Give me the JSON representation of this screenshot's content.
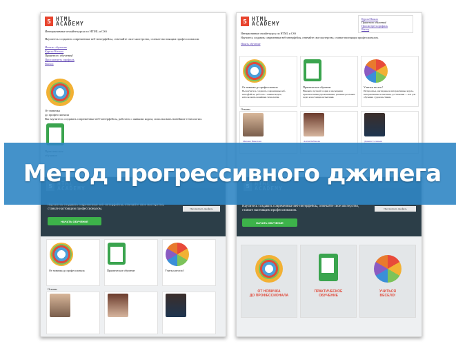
{
  "banner": {
    "title": "Метод прогрессивного джипега"
  },
  "logo": {
    "mark": "5",
    "line1": "HTML",
    "line2": "ACADEMY"
  },
  "top_left": {
    "tagline": "Интерактивные онлайн-курсы по HTML и CSS",
    "headline": "Научитесь создавать современные веб-интерфейсы, отвечайте свое мастерство, станьте настоящим профессионалом",
    "links": [
      "Начать обучение",
      "Курсы/Начало",
      "Приятного обучения!",
      "Просмотреть профиль",
      "Выход"
    ],
    "level_title_1": "От новичка",
    "level_title_2": "до профессионала",
    "level_text": "Вы научитесь создавать современные веб-интерфейсы, работать с живыми кодом, использовать новейшие технологии.",
    "practice_1": "Практическое",
    "practice_2": "обучение"
  },
  "top_right": {
    "links": [
      "Курсы/Начало",
      "Приятного обучения!",
      "Просмотреть профиль",
      "Выход"
    ],
    "tagline": "Интерактивные онлайн-курсы по HTML и CSS",
    "headline": "Научитесь создавать современные веб-интерфейсы, отвечайте свое мастерство, станьте настоящим профессионалом.",
    "cta": "Начать обучение",
    "col1_title": "От новичка до профессионала",
    "col1_text": "Вы научитесь создавать современные веб-интерфейсы, работать с живым кодом, использовать новейшие технологии.",
    "col2_title": "Практическое обучение",
    "col2_text": "Никаких скучной теории и насыщения практическими упражнениями, решение реальных задач и настоящие испытания.",
    "col3_title": "Учиться весело!",
    "col3_text": "Интересные, наглядные и интерактивные курсы, интерактивные испытания, достижения — всё для обучения с удовольствием.",
    "reviews": "Отзывы",
    "person1": "Михаил Николаев",
    "person2": "Алёна Бибенова",
    "person3": "Данила Соловьев"
  },
  "bottom_left": {
    "headline": "Научитесь создавать современные веб-интерфейсы, отвечайте свое мастерство, станьте настоящим профессионалом.",
    "cta": "НАЧАТЬ ОБУЧЕНИЕ",
    "profile": "Просмотреть профиль",
    "col1_title": "От новичка до профессионала",
    "col2_title": "Практическое обучение",
    "col3_title": "Учиться весело!",
    "reviews": "Отзывы"
  },
  "bottom_right": {
    "headline": "Научитесь создавать современные веб-интерфейсы, отвечайте свое мастерство, станьте настоящим профессионалом.",
    "cta": "НАЧАТЬ ОБУЧЕНИЕ",
    "profile": "Просмотреть профиль",
    "card1_title_1": "ОТ НОВИЧКА",
    "card1_title_2": "ДО ПРОФЕССИОНАЛА",
    "card2_title_1": "ПРАКТИЧЕСКОЕ",
    "card2_title_2": "ОБУЧЕНИЕ",
    "card3_title_1": "УЧИТЬСЯ",
    "card3_title_2": "ВЕСЕЛО!"
  },
  "colors": {
    "accent": "#e8442e",
    "banner": "#3086c4",
    "green": "#3db34a",
    "dark": "#2c3e48"
  }
}
